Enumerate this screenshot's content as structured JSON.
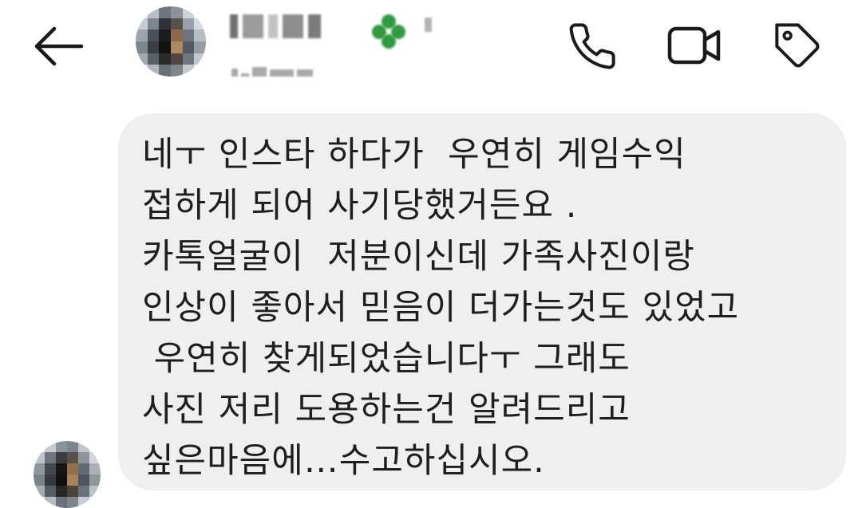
{
  "header": {
    "back_icon": "arrow-left-icon",
    "contact_avatar": "blurred-profile-photo",
    "contact_name": "",
    "contact_username": "",
    "badge_icon": "clover-emoji-icon",
    "actions": [
      {
        "name": "phone-call",
        "icon": "phone-icon"
      },
      {
        "name": "video-call",
        "icon": "video-camera-icon"
      },
      {
        "name": "tag",
        "icon": "tag-icon"
      }
    ]
  },
  "message": {
    "sender_avatar": "blurred-profile-photo",
    "bubble_color": "#efefef",
    "lines": [
      "네ㅜ 인스타 하다가  우연히 게임수익",
      "접하게 되어 사기당했거든요 .",
      "카톡얼굴이  저분이신데 가족사진이랑",
      "인상이 좋아서 믿음이 더가는것도 있었고",
      " 우연히 찾게되었습니다ㅜ 그래도",
      "사진 저리 도용하는건 알려드리고",
      "싶은마음에…수고하십시오."
    ]
  },
  "colors": {
    "background": "#ffffff",
    "text": "#1e1e1e",
    "icon": "#1a1a1a",
    "badge": "#2f9a3f"
  }
}
